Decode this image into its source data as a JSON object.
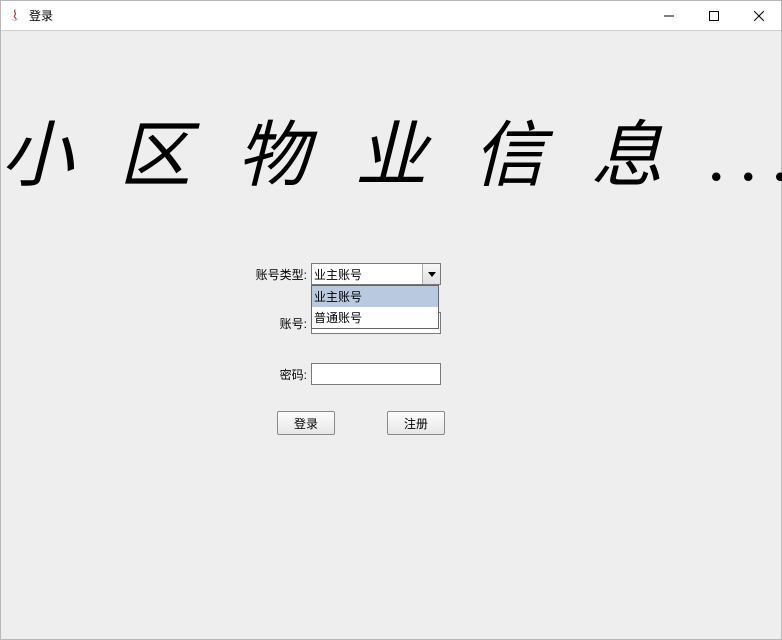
{
  "window": {
    "title": "登录"
  },
  "heading": "小 区 物 业 信 息 ...",
  "form": {
    "account_type_label": "账号类型:",
    "account_type_value": "业主账号",
    "account_type_options": [
      "业主账号",
      "普通账号"
    ],
    "account_label": "账号:",
    "account_value": "",
    "password_label": "密码:",
    "password_value": ""
  },
  "buttons": {
    "login": "登录",
    "register": "注册"
  }
}
